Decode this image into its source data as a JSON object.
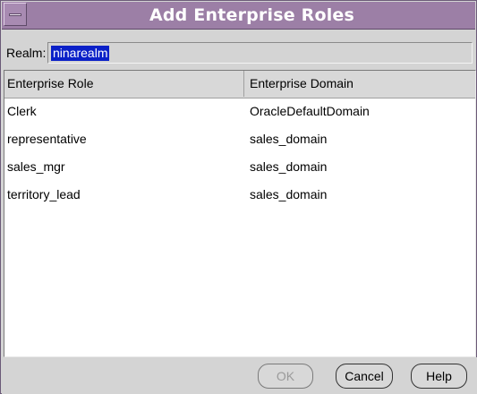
{
  "window": {
    "title": "Add Enterprise Roles"
  },
  "realm": {
    "label": "Realm:",
    "value": "ninarealm"
  },
  "table": {
    "columns": [
      "Enterprise Role",
      "Enterprise Domain"
    ],
    "rows": [
      [
        "Clerk",
        "OracleDefaultDomain"
      ],
      [
        "representative",
        "sales_domain"
      ],
      [
        "sales_mgr",
        "sales_domain"
      ],
      [
        "territory_lead",
        "sales_domain"
      ]
    ]
  },
  "buttons": {
    "ok": "OK",
    "cancel": "Cancel",
    "help": "Help"
  },
  "colors": {
    "titlebar": "#9c7fa6",
    "selection": "#0a20c8",
    "background": "#d4d4d4"
  }
}
